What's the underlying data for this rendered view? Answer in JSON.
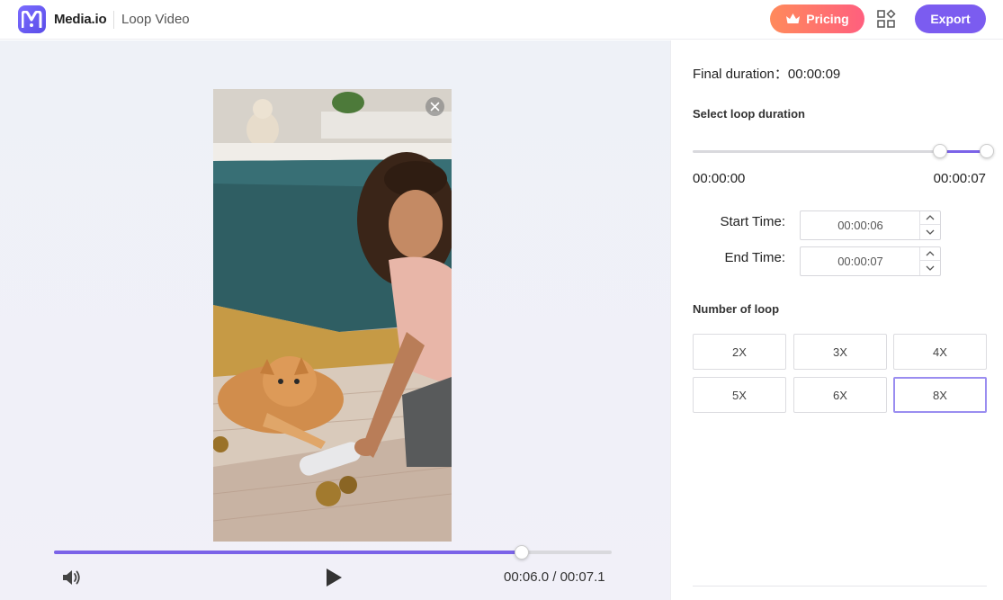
{
  "header": {
    "brand": "Media.io",
    "page_name": "Loop Video",
    "pricing_label": "Pricing",
    "export_label": "Export",
    "pricing_icon": "crown-icon",
    "apps_icon": "apps-grid-icon"
  },
  "player": {
    "current_time": "00:06.0",
    "total_time": "00:07.1",
    "time_separator": " / ",
    "progress": 0.838,
    "volume_icon": "volume-icon",
    "play_icon": "play-icon"
  },
  "panel": {
    "final_duration_label": "Final duration：",
    "final_duration_value": "00:00:09",
    "select_loop_title": "Select loop duration",
    "range_min_label": "00:00:00",
    "range_max_label": "00:00:07",
    "range_start_fraction": 0.84,
    "range_end_fraction": 1.0,
    "start_time_label": "Start Time:",
    "start_time_value": "00:00:06",
    "end_time_label": "End Time:",
    "end_time_value": "00:00:07",
    "loop_title": "Number of loop",
    "loop_options": [
      "2X",
      "3X",
      "4X",
      "5X",
      "6X",
      "8X"
    ],
    "selected_loop": "8X"
  },
  "colors": {
    "accent": "#7b63e8",
    "export_bg": "#7b5cf0",
    "pricing_gradient_start": "#ff8a5b",
    "pricing_gradient_end": "#ff5f7e"
  }
}
